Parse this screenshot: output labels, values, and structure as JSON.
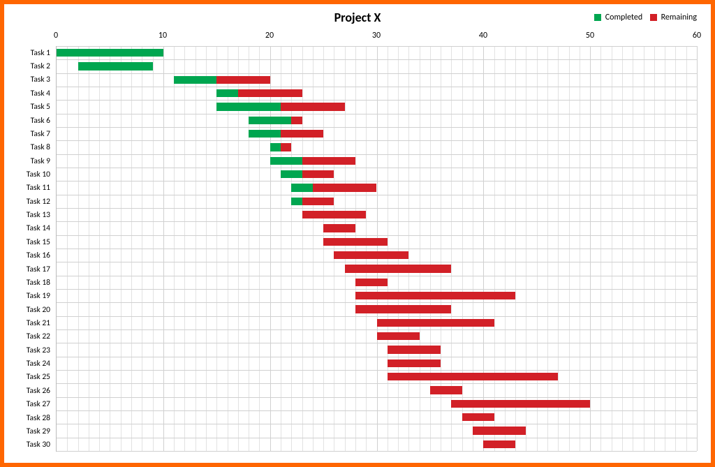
{
  "title": "Project X",
  "legend": {
    "completed": {
      "label": "Completed",
      "color": "#00a650"
    },
    "remaining": {
      "label": "Remaining",
      "color": "#d22027"
    }
  },
  "xaxis": {
    "min": 0,
    "max": 60,
    "major_step": 10,
    "minor_step": 1,
    "ticks": [
      0,
      10,
      20,
      30,
      40,
      50,
      60
    ]
  },
  "colors": {
    "completed": "#00a650",
    "remaining": "#d22027",
    "border": "#ff6600",
    "grid_major": "#d0d0d0",
    "grid_minor": "#e2e2e2"
  },
  "chart_data": {
    "type": "bar",
    "orientation": "horizontal",
    "stacked": true,
    "title": "Project X",
    "xlabel": "",
    "ylabel": "",
    "xlim": [
      0,
      60
    ],
    "categories": [
      "Task 1",
      "Task 2",
      "Task 3",
      "Task 4",
      "Task 5",
      "Task 6",
      "Task 7",
      "Task 8",
      "Task 9",
      "Task 10",
      "Task 11",
      "Task 12",
      "Task 13",
      "Task 14",
      "Task 15",
      "Task 16",
      "Task 17",
      "Task 18",
      "Task 19",
      "Task 20",
      "Task 21",
      "Task 22",
      "Task 23",
      "Task 24",
      "Task 25",
      "Task 26",
      "Task 27",
      "Task 28",
      "Task 29",
      "Task 30"
    ],
    "series": [
      {
        "name": "Start",
        "role": "offset",
        "values": [
          0,
          2,
          11,
          15,
          15,
          18,
          18,
          20,
          20,
          21,
          22,
          22,
          23,
          25,
          25,
          26,
          27,
          28,
          28,
          28,
          30,
          30,
          31,
          31,
          31,
          35,
          37,
          38,
          39,
          40
        ]
      },
      {
        "name": "Completed",
        "color": "#00a650",
        "values": [
          10,
          7,
          4,
          2,
          6,
          4,
          3,
          1,
          3,
          2,
          2,
          1,
          0,
          0,
          0,
          0,
          0,
          0,
          0,
          0,
          0,
          0,
          0,
          0,
          0,
          0,
          0,
          0,
          0,
          0
        ]
      },
      {
        "name": "Remaining",
        "color": "#d22027",
        "values": [
          0,
          0,
          5,
          6,
          6,
          1,
          4,
          1,
          5,
          3,
          6,
          3,
          6,
          3,
          6,
          7,
          10,
          3,
          15,
          9,
          11,
          4,
          5,
          5,
          16,
          3,
          13,
          3,
          5,
          3
        ]
      }
    ],
    "notes": "Horizontal stacked Gantt-style bar chart. 'Start' is an invisible offset; 'Completed' (green) and 'Remaining' (red) stack on top. X axis major gridlines every 10, minor every 1."
  }
}
